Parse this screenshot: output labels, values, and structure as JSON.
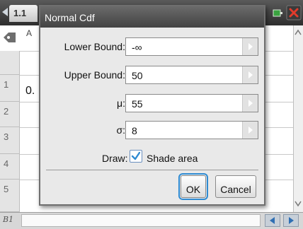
{
  "app": {
    "page_tab": "1.1",
    "column_label": "A",
    "row_numbers": [
      "1",
      "2",
      "3",
      "4",
      "5"
    ],
    "cell_a1_partial": "0.",
    "cell_ref": "B1"
  },
  "dialog": {
    "title": "Normal Cdf",
    "fields": [
      {
        "label": "Lower Bound:",
        "value": "-∞"
      },
      {
        "label": "Upper Bound:",
        "value": "50"
      },
      {
        "label": "μ:",
        "value": "55"
      },
      {
        "label": "σ:",
        "value": "8"
      }
    ],
    "draw_label": "Draw:",
    "shade_label": "Shade area",
    "shade_checked": true,
    "ok_label": "OK",
    "cancel_label": "Cancel"
  },
  "colors": {
    "accent": "#2f8bd2",
    "titlebar": "#4f4f4f",
    "close": "#d23a2a"
  },
  "icons": [
    "back-arrow-icon",
    "tag-icon",
    "battery-icon",
    "close-icon",
    "dropdown-arrow-icon",
    "checkmark-icon",
    "nav-left-icon",
    "nav-right-icon"
  ]
}
